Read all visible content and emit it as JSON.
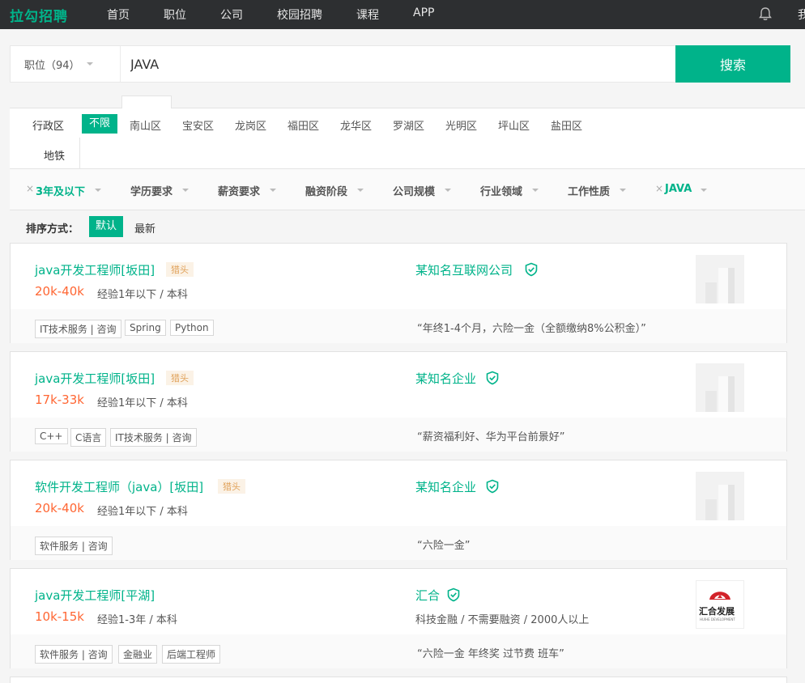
{
  "nav": {
    "logo": "拉勾招聘",
    "links": [
      "首页",
      "职位",
      "公司",
      "校园招聘",
      "课程",
      "APP"
    ],
    "user_partial": "我"
  },
  "search": {
    "type_label": "职位（94）",
    "query": "JAVA",
    "button": "搜索"
  },
  "district": {
    "label": "行政区",
    "active": "不限",
    "items": [
      "南山区",
      "宝安区",
      "龙岗区",
      "福田区",
      "龙华区",
      "罗湖区",
      "光明区",
      "坪山区",
      "盐田区"
    ],
    "metro": "地铁"
  },
  "conditions": {
    "items": [
      "3年及以下",
      "学历要求",
      "薪资要求",
      "融资阶段",
      "公司规模",
      "行业领域",
      "工作性质",
      "JAVA"
    ],
    "active": [
      "3年及以下",
      "JAVA"
    ],
    "remove_mark": "×"
  },
  "sort": {
    "label": "排序方式：",
    "default": "默认",
    "newest": "最新"
  },
  "jobs": [
    {
      "title": "java开发工程师[坂田]",
      "badge": "猎头",
      "salary": "20k-40k",
      "requirement": "经验1年以下 / 本科",
      "company": "某知名互联网公司",
      "industry": "",
      "tags": [
        "IT技术服务 | 咨询",
        "Spring",
        "Python"
      ],
      "benefit": "“年终1-4个月，六险一金（全额缴纳8%公积金）”"
    },
    {
      "title": "java开发工程师[坂田]",
      "badge": "猎头",
      "salary": "17k-33k",
      "requirement": "经验1年以下 / 本科",
      "company": "某知名企业",
      "industry": "",
      "tags": [
        "C++",
        "C语言",
        "IT技术服务 | 咨询"
      ],
      "benefit": "“薪资福利好、华为平台前景好”"
    },
    {
      "title": "软件开发工程师（java）[坂田]",
      "badge": "猎头",
      "salary": "20k-40k",
      "requirement": "经验1年以下 / 本科",
      "company": "某知名企业",
      "industry": "",
      "tags": [
        "软件服务 | 咨询"
      ],
      "benefit": "“六险一金”"
    },
    {
      "title": "java开发工程师[平湖]",
      "badge": "",
      "salary": "10k-15k",
      "requirement": "经验1-3年 / 本科",
      "company": "汇合",
      "industry": "科技金融 / 不需要融资 / 2000人以上",
      "tags": [
        "软件服务 | 咨询",
        "金融业",
        "后端工程师"
      ],
      "benefit": "“六险一金 年终奖 过节费 班车”",
      "logo_text": "汇合发展",
      "logo_sub": "HUIHE DEVELOPMENT"
    }
  ],
  "colors": {
    "brand": "#00b38a",
    "salary": "#ff6633",
    "nav_bg": "#2d2f31"
  }
}
